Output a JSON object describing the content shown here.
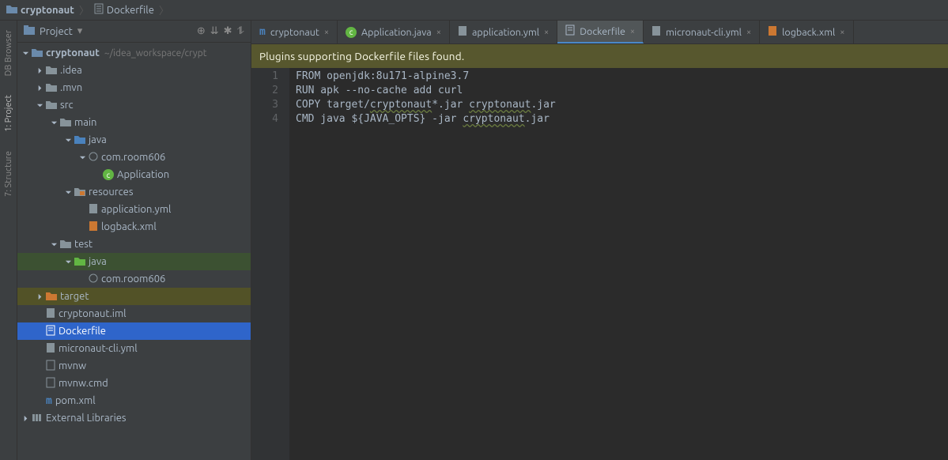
{
  "breadcrumb": {
    "root": "cryptonaut",
    "file": "Dockerfile"
  },
  "leftGutter": {
    "dbBrowser": "DB Browser",
    "project": "1: Project",
    "structure": "7: Structure"
  },
  "sidebar": {
    "title": "Project",
    "root": "cryptonaut",
    "rootPath": "~/idea_workspace/crypt",
    "idea": ".idea",
    "mvn": ".mvn",
    "src": "src",
    "main": "main",
    "java": "java",
    "package": "com.room606",
    "app": "Application",
    "resources": "resources",
    "appyml": "application.yml",
    "logback": "logback.xml",
    "test": "test",
    "testjava": "java",
    "testpackage": "com.room606",
    "target": "target",
    "iml": "cryptonaut.iml",
    "dockerfile": "Dockerfile",
    "microcli": "micronaut-cli.yml",
    "mvnw": "mvnw",
    "mvnwcmd": "mvnw.cmd",
    "pom": "pom.xml",
    "extlib": "External Libraries"
  },
  "tabs": {
    "t0": "cryptonaut",
    "t1": "Application.java",
    "t2": "application.yml",
    "t3": "Dockerfile",
    "t4": "micronaut-cli.yml",
    "t5": "logback.xml"
  },
  "notice": "Plugins supporting Dockerfile files found.",
  "code": {
    "l1a": "FROM openjdk:8u171-alpine3.7",
    "l2a": "RUN apk --no-cache add curl",
    "l3a": "COPY target/",
    "l3b": "cryptonaut",
    "l3c": "*.jar ",
    "l3d": "cryptonaut",
    "l3e": ".jar",
    "l4a": "CMD java ${JAVA_OPTS} -jar ",
    "l4b": "cryptonaut",
    "l4c": ".jar"
  },
  "linenums": {
    "n1": "1",
    "n2": "2",
    "n3": "3",
    "n4": "4"
  }
}
